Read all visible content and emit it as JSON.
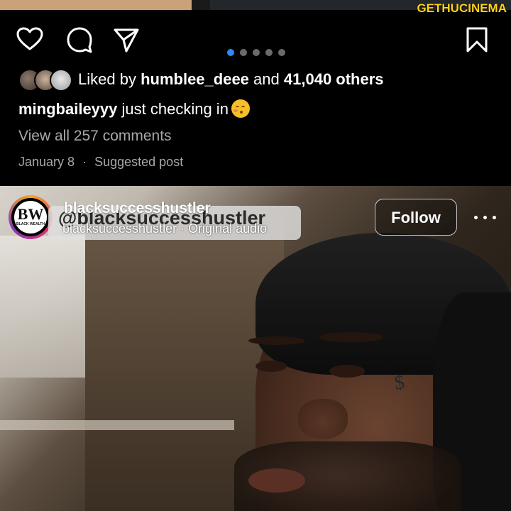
{
  "watermark": "GETHUCINEMA",
  "actions": {
    "icons": [
      "heart-icon",
      "comment-icon",
      "share-icon",
      "bookmark-icon"
    ],
    "carousel": {
      "count": 5,
      "active_index": 0,
      "active_color": "#2a8bf2"
    }
  },
  "likes": {
    "prefix": "Liked by",
    "user": "humblee_deee",
    "middle": "and",
    "others": "41,040 others"
  },
  "caption": {
    "user": "mingbaileyyy",
    "text": "just checking in"
  },
  "view_comments": "View all 257 comments",
  "meta": {
    "date": "January 8",
    "separator": "·",
    "label": "Suggested post"
  },
  "next_post": {
    "username": "blacksuccesshustler",
    "handle_overlay": "@blacksuccesshustler",
    "audio": "blacksuccesshustler · Original audio",
    "avatar_text": "BW",
    "avatar_subtext": "BLACK WEALTH",
    "follow_label": "Follow"
  }
}
